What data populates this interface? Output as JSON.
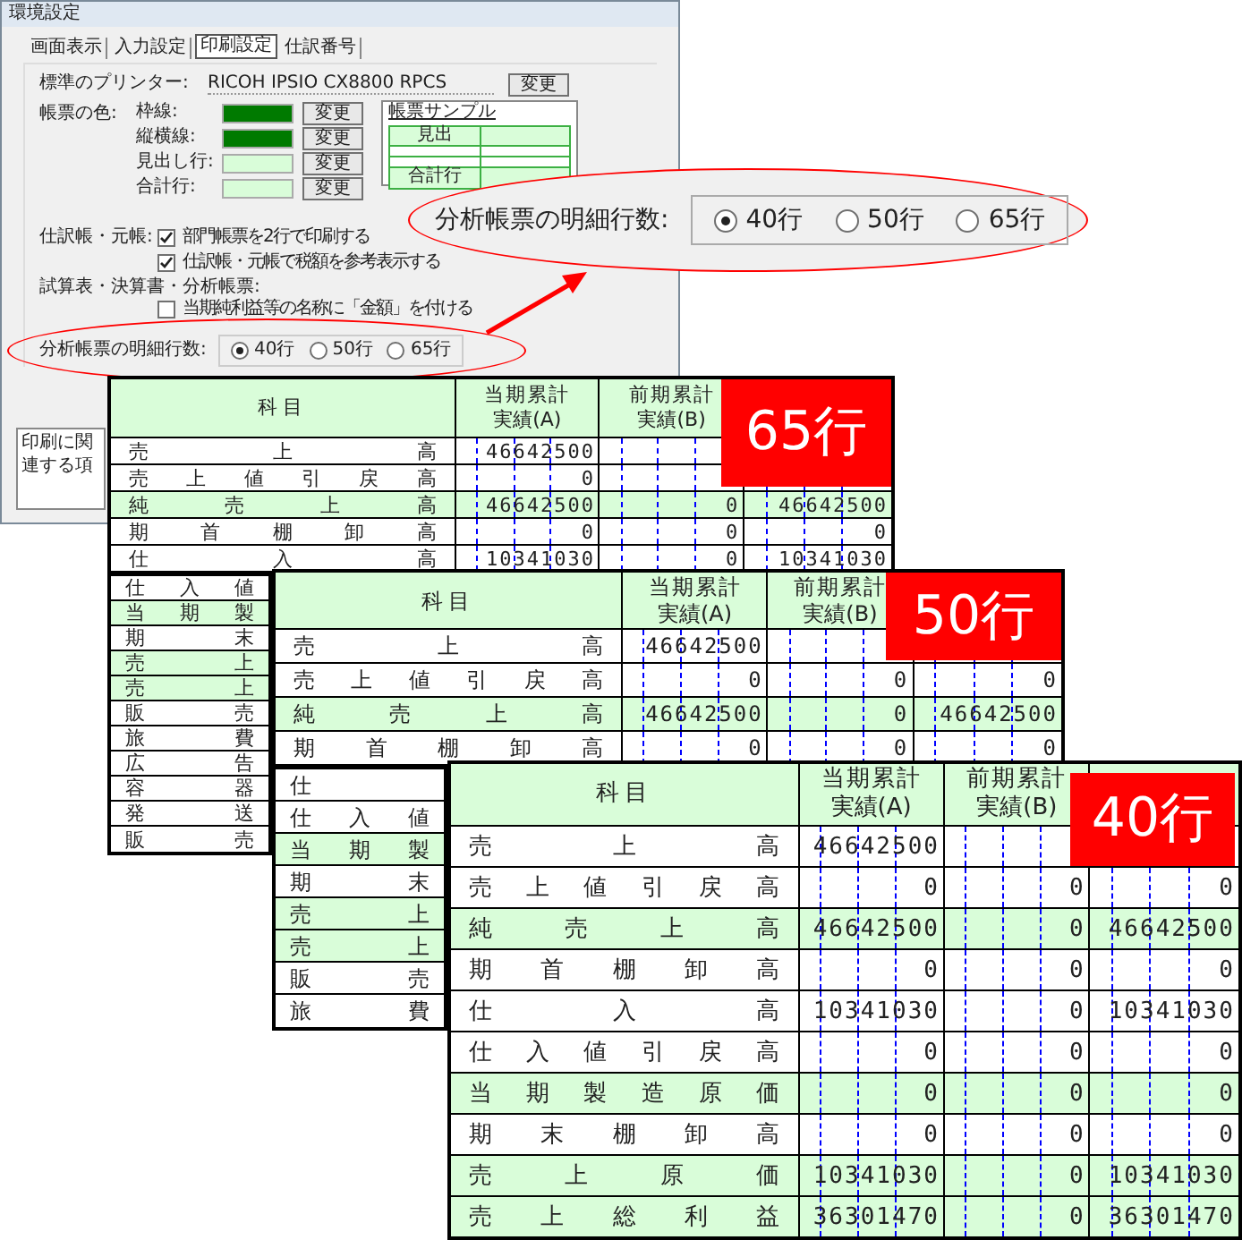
{
  "dialog": {
    "title": "環境設定",
    "tabs": [
      {
        "label": "画面表示",
        "selected": false
      },
      {
        "label": "入力設定",
        "selected": false
      },
      {
        "label": "印刷設定",
        "selected": true
      },
      {
        "label": "仕訳番号",
        "selected": false
      }
    ],
    "printer": {
      "label": "標準のプリンター:",
      "value": "RICOH IPSIO CX8800 RPCS",
      "button": "変更"
    },
    "colors": {
      "label": "帳票の色:",
      "items": [
        {
          "label": "枠線:",
          "color": "#007a00",
          "button": "変更"
        },
        {
          "label": "縦横線:",
          "color": "#007a00",
          "button": "変更"
        },
        {
          "label": "見出し行:",
          "color": "#d9fdd9",
          "button": "変更"
        },
        {
          "label": "合計行:",
          "color": "#d9fdd9",
          "button": "変更"
        }
      ]
    },
    "sample": {
      "title": "帳票サンプル",
      "header": "見出",
      "total": "合計行"
    },
    "ledger": {
      "label": "仕訳帳・元帳:",
      "options": [
        {
          "label": "部門帳票を2行で印刷する",
          "checked": true
        },
        {
          "label": "仕訳帳・元帳で税額を参考表示する",
          "checked": true
        }
      ]
    },
    "trial": {
      "label": "試算表・決算書・分析帳票:",
      "options": [
        {
          "label": "当期純利益等の名称に「金額」を付ける",
          "checked": false
        }
      ]
    },
    "rows_count": {
      "label": "分析帳票の明細行数:",
      "options": [
        {
          "label": "40行",
          "selected": true
        },
        {
          "label": "50行",
          "selected": false
        },
        {
          "label": "65行",
          "selected": false
        }
      ]
    },
    "note": "印刷に関連する項"
  },
  "callout": {
    "label": "分析帳票の明細行数:",
    "options": [
      {
        "label": "40行",
        "selected": true
      },
      {
        "label": "50行",
        "selected": false
      },
      {
        "label": "65行",
        "selected": false
      }
    ]
  },
  "reports": [
    {
      "badge": "65行",
      "subject": "科目",
      "col_a": [
        "当期累計",
        "実績(A)"
      ],
      "col_b": [
        "前期累計",
        "実績(B)"
      ],
      "rows": [
        {
          "subject": "売 上 高",
          "shaded": false,
          "values": {
            "current": "46642500"
          }
        },
        {
          "subject": "売 上 値 引 戻 高",
          "shaded": false,
          "values": {
            "current": "0"
          }
        },
        {
          "subject": "純 売 上 高",
          "shaded": true,
          "values": {
            "current": "46642500",
            "previous": "0",
            "column_3": "46642500"
          }
        },
        {
          "subject": "期 首 棚 卸 高",
          "shaded": false,
          "values": {
            "current": "0",
            "previous": "0",
            "column_3": "0"
          }
        },
        {
          "subject": "仕 入 高",
          "shaded": false,
          "values": {
            "current": "10341030",
            "previous": "0",
            "column_3": "10341030"
          }
        }
      ],
      "partial_rows": [
        {
          "subject": "仕 入 値",
          "shaded": false
        },
        {
          "subject": "当 期 製",
          "shaded": true
        },
        {
          "subject": "期 末",
          "shaded": false
        },
        {
          "subject": "売 上",
          "shaded": true
        },
        {
          "subject": "売 上",
          "shaded": true
        },
        {
          "subject": "販 売",
          "shaded": false
        },
        {
          "subject": "旅 費",
          "shaded": false
        },
        {
          "subject": "広 告",
          "shaded": false
        },
        {
          "subject": "容 器",
          "shaded": false
        },
        {
          "subject": "発 送",
          "shaded": false
        },
        {
          "subject": "販 売",
          "shaded": false
        }
      ]
    },
    {
      "badge": "50行",
      "subject": "科目",
      "col_a": [
        "当期累計",
        "実績(A)"
      ],
      "col_b": [
        "前期累計",
        "実績(B)"
      ],
      "rows": [
        {
          "subject": "売 上 高",
          "shaded": false,
          "values": {
            "current": "46642500"
          }
        },
        {
          "subject": "売 上 値 引 戻 高",
          "shaded": false,
          "values": {
            "current": "0",
            "previous": "0",
            "column_3": "0"
          }
        },
        {
          "subject": "純 売 上 高",
          "shaded": true,
          "values": {
            "current": "46642500",
            "previous": "0",
            "column_3": "46642500"
          }
        },
        {
          "subject": "期 首 棚 卸 高",
          "shaded": false,
          "values": {
            "current": "0",
            "previous": "0",
            "column_3": "0"
          }
        }
      ],
      "partial_rows": [
        {
          "subject": "仕",
          "shaded": false
        },
        {
          "subject": "仕 入 値",
          "shaded": false
        },
        {
          "subject": "当 期 製",
          "shaded": true
        },
        {
          "subject": "期 末",
          "shaded": false
        },
        {
          "subject": "売 上",
          "shaded": true
        },
        {
          "subject": "売 上",
          "shaded": true
        },
        {
          "subject": "販 売",
          "shaded": false
        },
        {
          "subject": "旅 費",
          "shaded": false
        }
      ]
    },
    {
      "badge": "40行",
      "subject": "科目",
      "col_a": [
        "当期累計",
        "実績(A)"
      ],
      "col_b": [
        "前期累計",
        "実績(B)"
      ],
      "rows": [
        {
          "subject": "売 上 高",
          "shaded": false,
          "values": {
            "current": "46642500"
          }
        },
        {
          "subject": "売 上 値 引 戻 高",
          "shaded": false,
          "values": {
            "current": "0",
            "previous": "0",
            "column_3": "0"
          }
        },
        {
          "subject": "純 売 上 高",
          "shaded": true,
          "values": {
            "current": "46642500",
            "previous": "0",
            "column_3": "46642500"
          }
        },
        {
          "subject": "期 首 棚 卸 高",
          "shaded": false,
          "values": {
            "current": "0",
            "previous": "0",
            "column_3": "0"
          }
        },
        {
          "subject": "仕 入 高",
          "shaded": false,
          "values": {
            "current": "10341030",
            "previous": "0",
            "column_3": "10341030"
          }
        },
        {
          "subject": "仕 入 値 引 戻 高",
          "shaded": false,
          "values": {
            "current": "0",
            "previous": "0",
            "column_3": "0"
          }
        },
        {
          "subject": "当 期 製 造 原 価",
          "shaded": true,
          "values": {
            "current": "0",
            "previous": "0",
            "column_3": "0"
          }
        },
        {
          "subject": "期 末 棚 卸 高",
          "shaded": false,
          "values": {
            "current": "0",
            "previous": "0",
            "column_3": "0"
          }
        },
        {
          "subject": "売 上 原 価",
          "shaded": true,
          "values": {
            "current": "10341030",
            "previous": "0",
            "column_3": "10341030"
          }
        },
        {
          "subject": "売 上 総 利 益",
          "shaded": true,
          "values": {
            "current": "36301470",
            "previous": "0",
            "column_3": "36301470"
          }
        }
      ]
    }
  ]
}
